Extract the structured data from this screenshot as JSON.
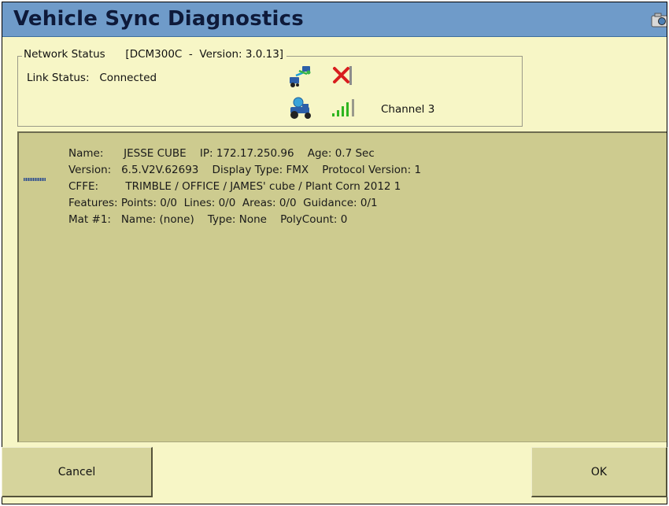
{
  "window": {
    "title": "Vehicle Sync Diagnostics"
  },
  "network_status": {
    "legend": "Network Status      [DCM300C  -  Version: 3.0.13]",
    "link_status": "Link Status:   Connected",
    "channel": "Channel 3",
    "icons": {
      "sync": "vehicle-sync-icon",
      "link_error": "red-x-icon",
      "tractor": "tractor-icon",
      "signal": "signal-strength-icon"
    }
  },
  "info": {
    "lines": [
      "Name:      JESSE CUBE    IP: 172.17.250.96    Age: 0.7 Sec",
      "Version:   6.5.V2V.62693    Display Type: FMX    Protocol Version: 1",
      "CFFE:        TRIMBLE / OFFICE / JAMES' cube / Plant Corn 2012 1",
      "Features: Points: 0/0  Lines: 0/0  Areas: 0/0  Guidance: 0/1",
      "Mat #1:   Name: (none)    Type: None    PolyCount: 0"
    ]
  },
  "buttons": {
    "cancel": "Cancel",
    "ok": "OK"
  },
  "colors": {
    "title_bar": "#6f9bc9",
    "background": "#f7f6c6",
    "panel": "#cdcb8f",
    "button": "#d6d49c",
    "error_red": "#d81e1e",
    "signal_green": "#2fb51f"
  }
}
